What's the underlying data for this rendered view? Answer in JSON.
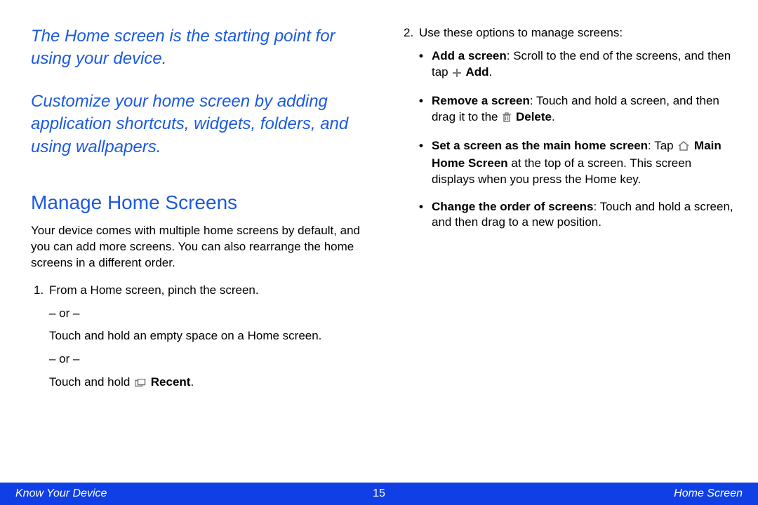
{
  "left": {
    "intro1": "The Home screen is the starting point for using your device.",
    "intro2": "Customize your home screen by adding application shortcuts, widgets, folders, and using wallpapers.",
    "heading": "Manage Home Screens",
    "para": "Your device comes with multiple home screens by default, and you can add more screens. You can also rearrange the home screens in a different order.",
    "step1_num": "1.",
    "step1_text": "From a Home screen, pinch the screen.",
    "or1": "– or –",
    "alt1": "Touch and hold an empty space on a Home screen.",
    "or2": "– or –",
    "alt2_pre": "Touch and hold ",
    "alt2_label": " Recent",
    "alt2_post": "."
  },
  "right": {
    "step2_num": "2.",
    "step2_text": "Use these options to manage screens:",
    "b1_lead": "Add a screen",
    "b1_t1": ": Scroll to the end of the screens, and then tap ",
    "b1_label": " Add",
    "b1_t2": ".",
    "b2_lead": "Remove a screen",
    "b2_t1": ": Touch and hold a screen, and then drag it to the ",
    "b2_label": " Delete",
    "b2_t2": ".",
    "b3_lead": "Set a screen as the main home screen",
    "b3_colon": ": ",
    "b3_t1": "Tap ",
    "b3_label": " Main Home Screen",
    "b3_t2": " at the top of a screen. This screen displays when you press the Home key.",
    "b4_lead": "Change the order of screens",
    "b4_t1": ": Touch and hold a screen, and then drag to a new position."
  },
  "footer": {
    "left": "Know Your Device",
    "center": "15",
    "right": "Home Screen"
  }
}
